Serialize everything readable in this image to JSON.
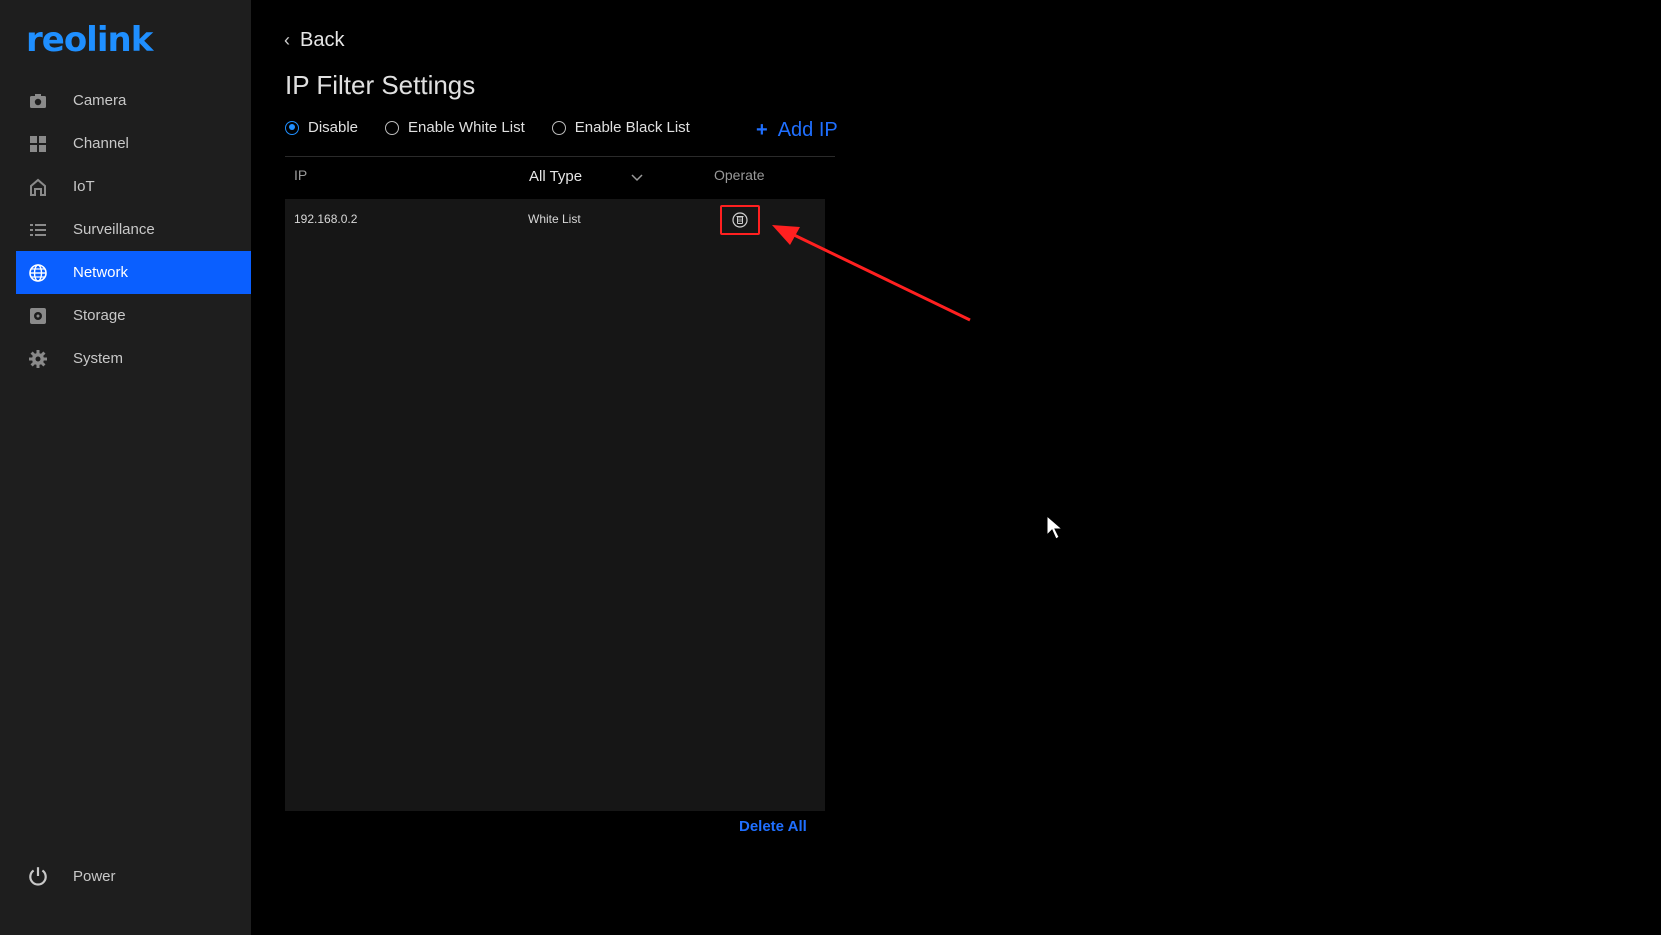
{
  "brand": {
    "logo_text": "reolink",
    "color": "#1f8fff"
  },
  "sidebar": {
    "items": [
      {
        "label": "Camera",
        "icon": "camera-icon",
        "active": false
      },
      {
        "label": "Channel",
        "icon": "grid-icon",
        "active": false
      },
      {
        "label": "IoT",
        "icon": "home-icon",
        "active": false
      },
      {
        "label": "Surveillance",
        "icon": "list-icon",
        "active": false
      },
      {
        "label": "Network",
        "icon": "globe-icon",
        "active": true
      },
      {
        "label": "Storage",
        "icon": "storage-icon",
        "active": false
      },
      {
        "label": "System",
        "icon": "gear-icon",
        "active": false
      }
    ],
    "power_label": "Power",
    "active_color": "#0a5fff"
  },
  "header": {
    "back_label": "Back",
    "title": "IP Filter Settings"
  },
  "filter_mode": {
    "options": [
      {
        "label": "Disable",
        "selected": true
      },
      {
        "label": "Enable White List",
        "selected": false
      },
      {
        "label": "Enable Black List",
        "selected": false
      }
    ],
    "add_ip_label": "Add IP"
  },
  "table": {
    "columns": {
      "ip": "IP",
      "type": "All Type",
      "operate": "Operate"
    },
    "rows": [
      {
        "ip": "192.168.0.2",
        "type": "White List"
      }
    ],
    "delete_all_label": "Delete All"
  },
  "annotation": {
    "highlight_color": "#ff2020"
  }
}
